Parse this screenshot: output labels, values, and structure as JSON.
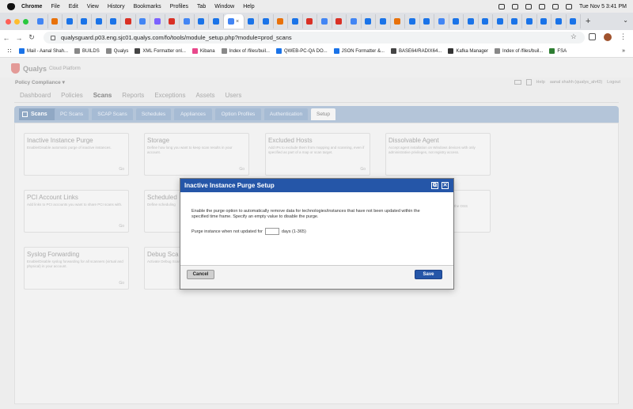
{
  "menubar": {
    "app": "Chrome",
    "items": [
      "File",
      "Edit",
      "View",
      "History",
      "Bookmarks",
      "Profiles",
      "Tab",
      "Window",
      "Help"
    ],
    "datetime": "Tue Nov 5  3:41 PM"
  },
  "browser": {
    "url": "qualysguard.p03.eng.sjc01.qualys.com/fo/tools/module_setup.php?module=prod_scans",
    "tab_favicon_colors": [
      "#4285f4",
      "#e8710a",
      "#1a73e8",
      "#1a73e8",
      "#1a73e8",
      "#1a73e8",
      "#d93025",
      "#4285f4",
      "#7b61ff",
      "#d93025",
      "#4285f4",
      "#1a73e8",
      "#1a73e8",
      "#4285f4",
      "#1a73e8",
      "#1a73e8",
      "#e8710a",
      "#1a73e8",
      "#d93025",
      "#4285f4",
      "#d93025",
      "#4285f4",
      "#1a73e8",
      "#1a73e8",
      "#e8710a",
      "#1a73e8",
      "#1a73e8",
      "#4285f4",
      "#1a73e8",
      "#1a73e8",
      "#1a73e8",
      "#1a73e8",
      "#1a73e8",
      "#1a73e8",
      "#1a73e8",
      "#1a73e8",
      "#1a73e8"
    ]
  },
  "bookmarks": [
    {
      "label": "Mail - Aanal Shah...",
      "color": "#1a73e8"
    },
    {
      "label": "BUILDS",
      "color": "#888888"
    },
    {
      "label": "Qualys",
      "color": "#888888"
    },
    {
      "label": "XML Formatter onl...",
      "color": "#444444"
    },
    {
      "label": "Kibana",
      "color": "#e8478b"
    },
    {
      "label": "Index of /files/buil...",
      "color": "#888888"
    },
    {
      "label": "QWEB-PC-QA DO...",
      "color": "#1a73e8"
    },
    {
      "label": "JSON Formatter &...",
      "color": "#1a73e8"
    },
    {
      "label": "BASE64/RADIX64...",
      "color": "#444444"
    },
    {
      "label": "Kafka Manager",
      "color": "#333333"
    },
    {
      "label": "Index of /files/buil...",
      "color": "#888888"
    },
    {
      "label": "FSA",
      "color": "#2e7d32"
    }
  ],
  "app": {
    "brand": "Qualys",
    "brand_sub": "Cloud Platform",
    "module": "Policy Compliance",
    "help": "Help",
    "user": "aanal shahh (qualys_ah43)",
    "logout": "Logout",
    "main_nav": [
      "Dashboard",
      "Policies",
      "Scans",
      "Reports",
      "Exceptions",
      "Assets",
      "Users"
    ],
    "main_nav_active": "Scans",
    "section_title": "Scans",
    "sub_tabs": [
      "PC Scans",
      "SCAP Scans",
      "Schedules",
      "Appliances",
      "Option Profiles",
      "Authentication",
      "Setup"
    ],
    "sub_tabs_active": "Setup",
    "cards": [
      {
        "title": "Inactive Instance Purge",
        "desc": "Enable/Disable automatic purge of inactive instances.",
        "go": "Go"
      },
      {
        "title": "Storage",
        "desc": "Define how long you want to keep scan results in your account.",
        "go": "Go"
      },
      {
        "title": "Excluded Hosts",
        "desc": "Add IPs to exclude them from mapping and scanning, even if specified as part of a map or scan target.",
        "go": "Go"
      },
      {
        "title": "Dissolvable Agent",
        "desc": "Accept agent installation on Windows devices with only administrative privileges, not registry access.",
        "go": ""
      },
      {
        "title": "PCI Account Links",
        "desc": "Add links to PCI accounts you want to share PCI scans with.",
        "go": "Go"
      },
      {
        "title": "Scheduled",
        "desc": "Define scheduling",
        "go": ""
      },
      {
        "title": "",
        "desc": "the OSS",
        "go": ""
      },
      {
        "title": "Syslog Forwarding",
        "desc": "Enable/Disable syslog forwarding for all scanners (virtual and physical) in your account.",
        "go": "Go"
      },
      {
        "title": "Debug Sca",
        "desc": "Activate Debug Scan",
        "go": ""
      }
    ]
  },
  "modal": {
    "title": "Inactive Instance Purge Setup",
    "description": "Enable the purge option to automatically remove data for technologies/instances that have not been updated within the specified time frame. Specify an empty value to disable the purge.",
    "field_label": "Purge instance when not updated for",
    "field_value": "",
    "field_suffix": "days (1-365)",
    "cancel": "Cancel",
    "save": "Save"
  }
}
